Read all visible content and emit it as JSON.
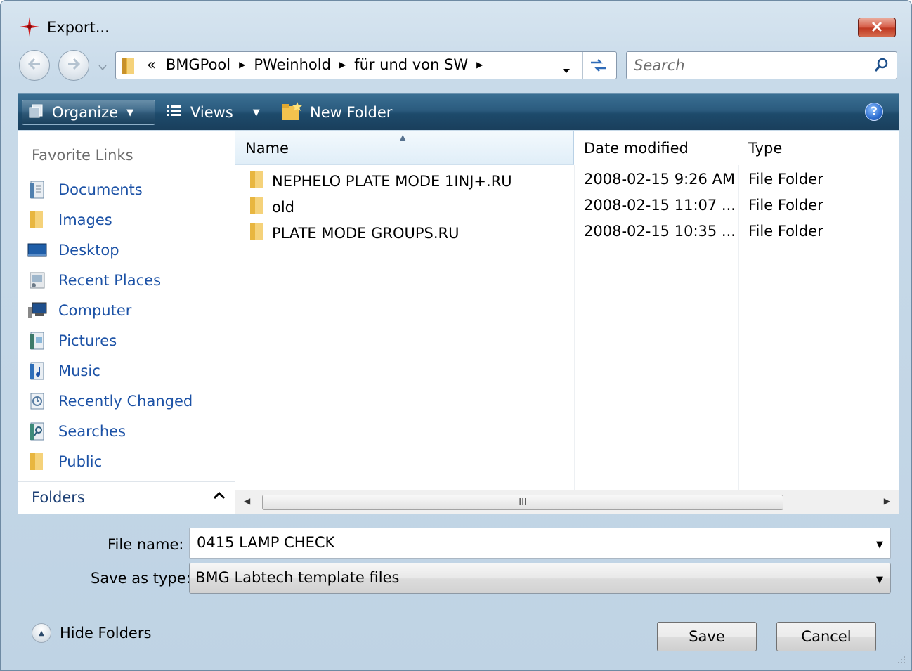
{
  "window": {
    "title": "Export..."
  },
  "nav": {
    "breadcrumb_prefix": "«",
    "crumbs": [
      "BMGPool",
      "PWeinhold",
      "für und von SW"
    ],
    "search_placeholder": "Search"
  },
  "toolbar": {
    "organize": "Organize",
    "views": "Views",
    "new_folder": "New Folder",
    "help": "?"
  },
  "sidebar": {
    "title": "Favorite Links",
    "items": [
      {
        "label": "Documents",
        "icon": "documents-icon"
      },
      {
        "label": "Images",
        "icon": "folder-icon"
      },
      {
        "label": "Desktop",
        "icon": "desktop-icon"
      },
      {
        "label": "Recent Places",
        "icon": "recent-places-icon"
      },
      {
        "label": "Computer",
        "icon": "computer-icon"
      },
      {
        "label": "Pictures",
        "icon": "pictures-icon"
      },
      {
        "label": "Music",
        "icon": "music-icon"
      },
      {
        "label": "Recently Changed",
        "icon": "recently-changed-icon"
      },
      {
        "label": "Searches",
        "icon": "searches-icon"
      },
      {
        "label": "Public",
        "icon": "folder-icon"
      }
    ],
    "folders_label": "Folders"
  },
  "filelist": {
    "columns": [
      "Name",
      "Date modified",
      "Type"
    ],
    "rows": [
      {
        "name": "NEPHELO PLATE MODE 1INJ+.RU",
        "date": "2008-02-15 9:26 AM",
        "type": "File Folder"
      },
      {
        "name": "old",
        "date": "2008-02-15 11:07 ...",
        "type": "File Folder"
      },
      {
        "name": "PLATE MODE GROUPS.RU",
        "date": "2008-02-15 10:35 ...",
        "type": "File Folder"
      }
    ],
    "scroll_thumb_label": "III"
  },
  "form": {
    "file_name_label": "File name:",
    "file_name_value": "0415 LAMP CHECK",
    "save_type_label": "Save as type:",
    "save_type_value": "BMG Labtech template files"
  },
  "footer": {
    "hide_folders": "Hide Folders",
    "save": "Save",
    "cancel": "Cancel"
  },
  "colors": {
    "toolbar": "#2b5b7e",
    "link": "#1c52a6",
    "close": "#c03a23"
  }
}
